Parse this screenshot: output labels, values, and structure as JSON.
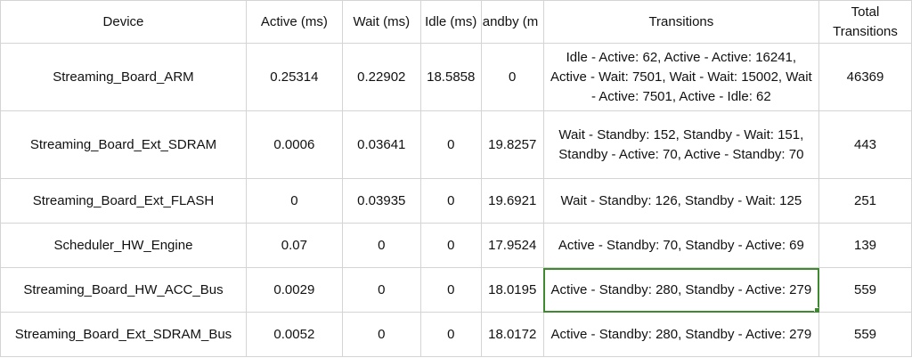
{
  "headers": {
    "device": "Device",
    "active": "Active (ms)",
    "wait": "Wait (ms)",
    "idle": "Idle (ms)",
    "standby": "andby (m",
    "transitions": "Transitions",
    "total": "Total Transitions"
  },
  "rows": [
    {
      "device": "Streaming_Board_ARM",
      "active": "0.25314",
      "wait": "0.22902",
      "idle": "18.5858",
      "standby": "0",
      "transitions": "Idle - Active: 62, Active - Active: 16241, Active - Wait: 7501, Wait - Wait: 15002, Wait - Active: 7501, Active - Idle: 62",
      "total": "46369"
    },
    {
      "device": "Streaming_Board_Ext_SDRAM",
      "active": "0.0006",
      "wait": "0.03641",
      "idle": "0",
      "standby": "19.8257",
      "transitions": "Wait - Standby: 152, Standby - Wait: 151, Standby - Active: 70, Active - Standby: 70",
      "total": "443"
    },
    {
      "device": "Streaming_Board_Ext_FLASH",
      "active": "0",
      "wait": "0.03935",
      "idle": "0",
      "standby": "19.6921",
      "transitions": "Wait - Standby: 126, Standby - Wait: 125",
      "total": "251"
    },
    {
      "device": "Scheduler_HW_Engine",
      "active": "0.07",
      "wait": "0",
      "idle": "0",
      "standby": "17.9524",
      "transitions": "Active - Standby: 70, Standby - Active: 69",
      "total": "139"
    },
    {
      "device": "Streaming_Board_HW_ACC_Bus",
      "active": "0.0029",
      "wait": "0",
      "idle": "0",
      "standby": "18.0195",
      "transitions": "Active - Standby: 280, Standby - Active: 279",
      "total": "559"
    },
    {
      "device": "Streaming_Board_Ext_SDRAM_Bus",
      "active": "0.0052",
      "wait": "0",
      "idle": "0",
      "standby": "18.0172",
      "transitions": "Active - Standby: 280, Standby - Active: 279",
      "total": "559"
    }
  ],
  "colors": {
    "selection": "#3f8a30",
    "gridline": "#d4d4d4"
  }
}
